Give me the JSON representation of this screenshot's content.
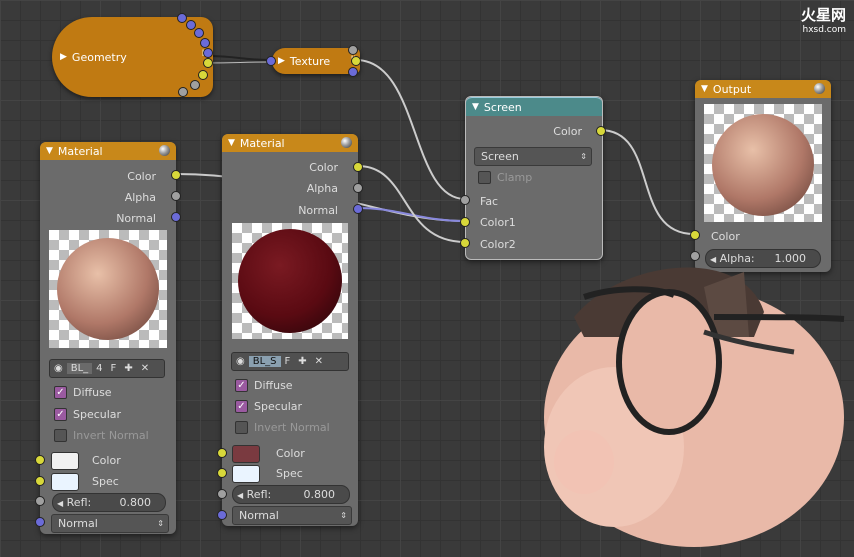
{
  "watermark": {
    "brand": "火星网",
    "url": "hxsd.com"
  },
  "geometry": {
    "title": "Geometry",
    "pause": "II"
  },
  "texture": {
    "title": "Texture",
    "pause": "II"
  },
  "material1": {
    "title": "Material",
    "outputs": [
      "Color",
      "Alpha",
      "Normal"
    ],
    "mat_name": "BL_",
    "users": "4",
    "fake": "F",
    "diffuse": "Diffuse",
    "specular": "Specular",
    "invert_normal": "Invert Normal",
    "color_label": "Color",
    "spec_label": "Spec",
    "refl_label": "Refl:",
    "refl_value": "0.800",
    "normal_label": "Normal"
  },
  "material2": {
    "title": "Material",
    "outputs": [
      "Color",
      "Alpha",
      "Normal"
    ],
    "mat_name": "BL_S",
    "fake": "F",
    "diffuse": "Diffuse",
    "specular": "Specular",
    "invert_normal": "Invert Normal",
    "color_label": "Color",
    "spec_label": "Spec",
    "refl_label": "Refl:",
    "refl_value": "0.800",
    "normal_label": "Normal"
  },
  "screen": {
    "title": "Screen",
    "color_out": "Color",
    "blend_mode": "Screen",
    "clamp": "Clamp",
    "inputs": [
      "Fac",
      "Color1",
      "Color2"
    ]
  },
  "output": {
    "title": "Output",
    "color_in": "Color",
    "alpha_label": "Alpha:",
    "alpha_value": "1.000"
  },
  "colors": {
    "header": "#c8881a",
    "screen_header": "#4c8a8a",
    "socket_yellow": "#d8d83a",
    "socket_blue": "#6b6bd8",
    "socket_gray": "#a0a0a0",
    "mat2_color": "#7a3a40",
    "white": "#ffffff",
    "spec_white": "#eaf4ff"
  }
}
